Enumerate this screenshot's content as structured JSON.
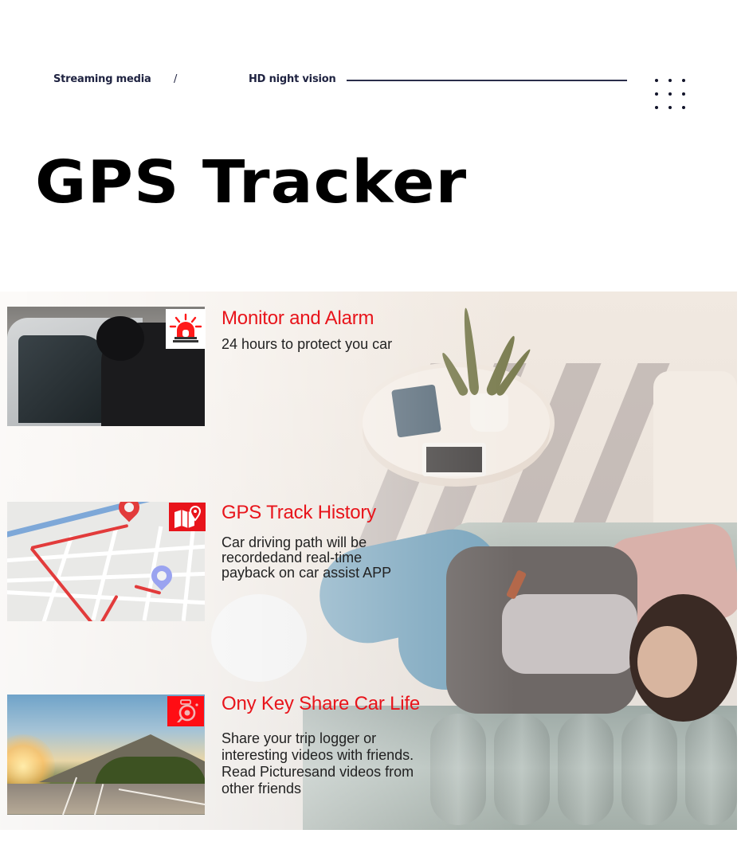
{
  "header": {
    "crumbs": [
      "Streaming media",
      "/",
      "HD night vision"
    ],
    "menu_icon": "dot-grid-icon"
  },
  "title": "GPS Tracker",
  "colors": {
    "accent_red": "#e8141b",
    "heading_navy": "#1e2240",
    "title_black": "#000000"
  },
  "features": [
    {
      "title": "Monitor and Alarm",
      "description": "24 hours to protect you car",
      "icon": "siren-alarm-icon",
      "image": "car-thief-photo"
    },
    {
      "title": "GPS Track History",
      "description": "Car driving path will be\nrecordedand real-time\npayback on car assist APP",
      "icon": "map-pin-icon",
      "image": "route-map-photo"
    },
    {
      "title": "Ony Key Share Car Life",
      "description": "Share your trip logger or\ninteresting videos with friends.\nRead Picturesand videos from\nother friends",
      "icon": "camera-icon",
      "image": "highway-landscape-photo"
    }
  ],
  "background_image": "woman-on-sofa-with-phone-photo"
}
